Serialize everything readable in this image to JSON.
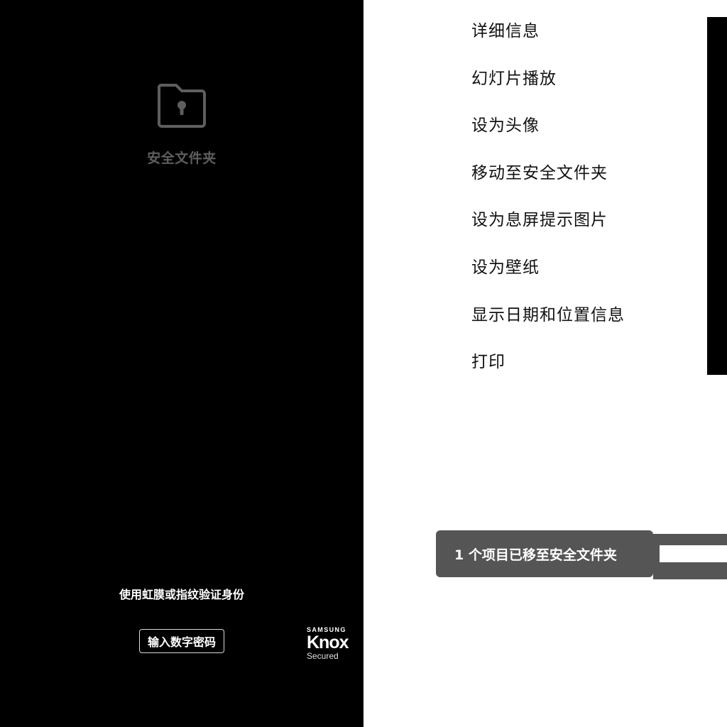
{
  "lock_screen": {
    "folder_icon": "folder-lock-icon",
    "title": "安全文件夹",
    "verify_prompt": "使用虹膜或指纹验证身份",
    "pin_button_label": "输入数字密码",
    "knox_logo": {
      "brand": "SAMSUNG",
      "name": "Knox",
      "tagline": "Secured"
    }
  },
  "menu": {
    "items": [
      "详细信息",
      "幻灯片播放",
      "设为头像",
      "移动至安全文件夹",
      "设为息屏提示图片",
      "设为壁纸",
      "显示日期和位置信息",
      "打印"
    ]
  },
  "toast": {
    "message": "1 个项目已移至安全文件夹"
  },
  "colors": {
    "lock_background": "#000000",
    "folder_icon": "#5e5e5e",
    "toast_background": "#555555",
    "menu_text": "#111111"
  }
}
